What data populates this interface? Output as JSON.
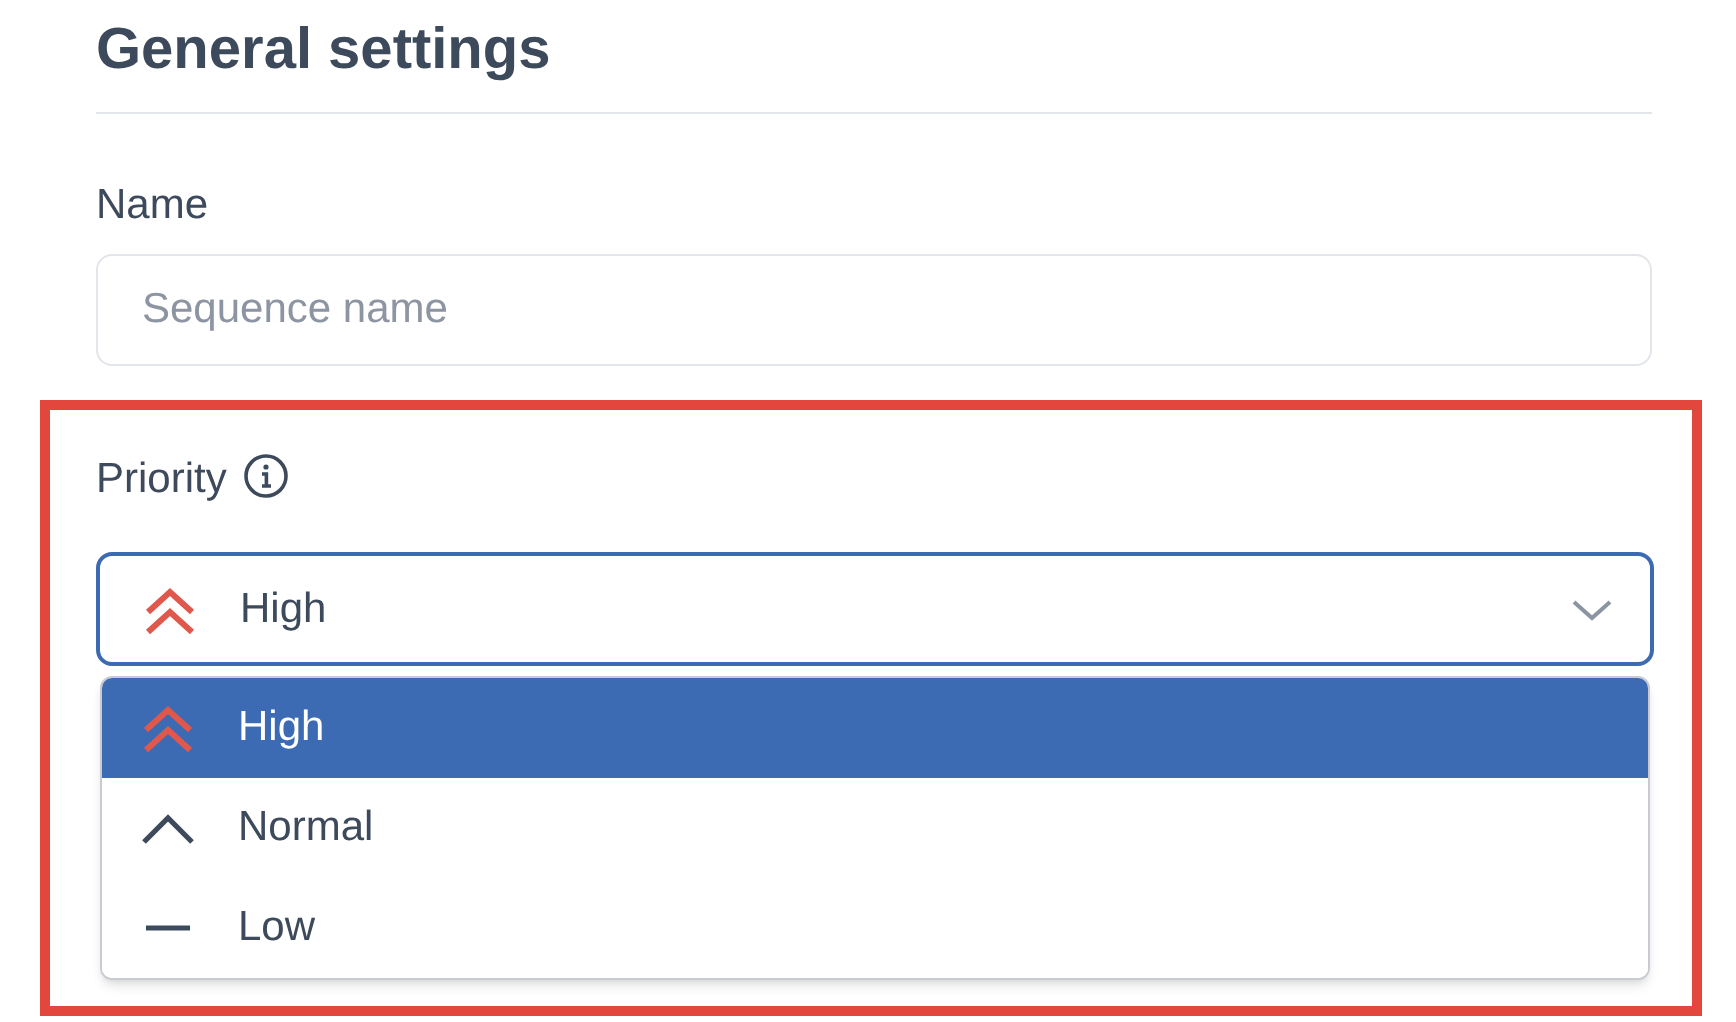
{
  "section": {
    "title": "General settings"
  },
  "name_field": {
    "label": "Name",
    "placeholder": "Sequence name"
  },
  "priority": {
    "label": "Priority",
    "expanded": true,
    "value": {
      "label": "High",
      "kind": "high"
    },
    "options": [
      {
        "label": "High",
        "kind": "high",
        "selected": true
      },
      {
        "label": "Normal",
        "kind": "normal",
        "selected": false
      },
      {
        "label": "Low",
        "kind": "low",
        "selected": false
      }
    ]
  }
}
